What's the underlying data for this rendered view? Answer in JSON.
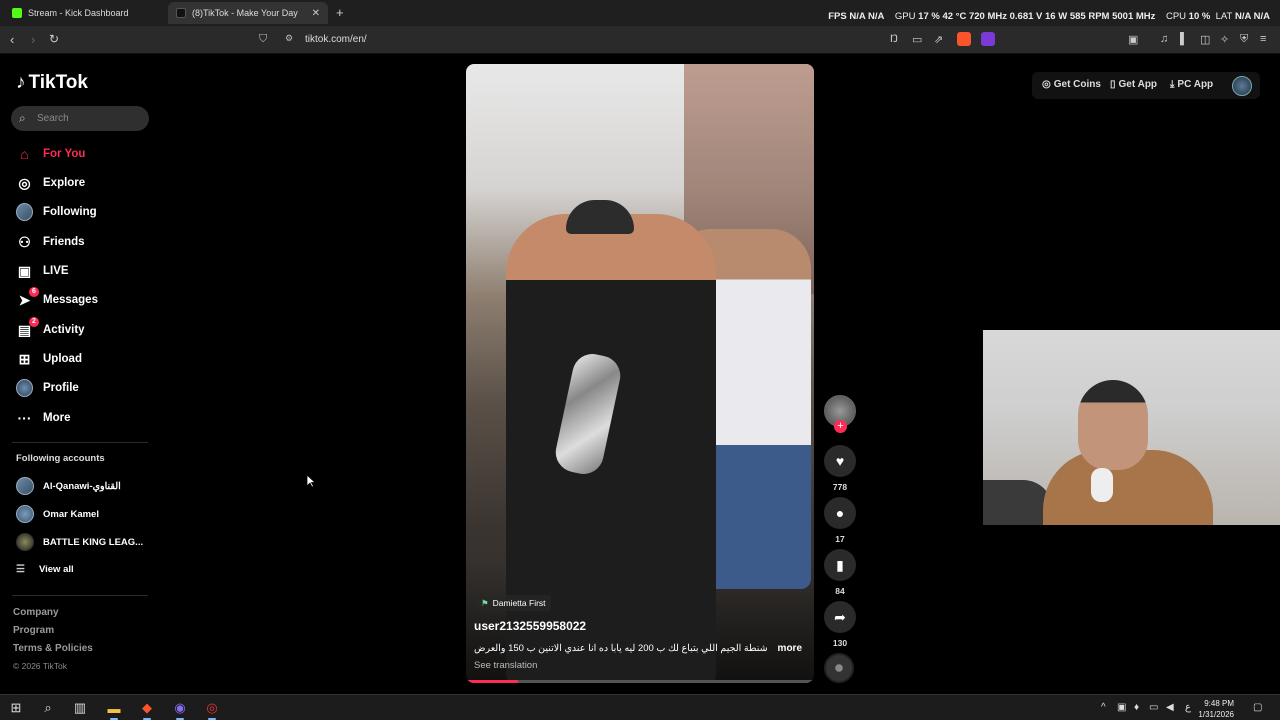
{
  "browser": {
    "tabs": [
      {
        "title": "Stream - Kick Dashboard",
        "favicon_color": "#53fc18"
      },
      {
        "title": "(8)TikTok - Make Your Day",
        "favicon_color": "#111111"
      }
    ],
    "url": "tiktok.com/en/"
  },
  "overlay": {
    "fps_label": "FPS",
    "fps1": "N/A",
    "fps2": "N/A",
    "gpu_label": "GPU",
    "gpu_load": "17 %",
    "gpu_temp": "42 °C",
    "gpu_clock": "720 MHz",
    "gpu_volt": "0.681 V",
    "gpu_power": "16 W",
    "gpu_fan": "585 RPM",
    "gpu_mem": "5001 MHz",
    "cpu_label": "CPU",
    "cpu_load": "10 %",
    "lat_label": "LAT",
    "lat1": "N/A",
    "lat2": "N/A"
  },
  "sidebar": {
    "logo": "TikTok",
    "search_placeholder": "Search",
    "nav": [
      {
        "label": "For You",
        "icon": "home-icon"
      },
      {
        "label": "Explore",
        "icon": "compass-icon"
      },
      {
        "label": "Following",
        "icon": "avatar-icon"
      },
      {
        "label": "Friends",
        "icon": "friends-icon"
      },
      {
        "label": "LIVE",
        "icon": "live-icon"
      },
      {
        "label": "Messages",
        "icon": "messages-icon",
        "badge": "6"
      },
      {
        "label": "Activity",
        "icon": "activity-icon",
        "badge": "2"
      },
      {
        "label": "Upload",
        "icon": "upload-icon"
      },
      {
        "label": "Profile",
        "icon": "profile-icon"
      },
      {
        "label": "More",
        "icon": "more-icon"
      }
    ],
    "following_title": "Following accounts",
    "accounts": [
      "Al-Qanawi-القناوي",
      "Omar Kamel",
      "BATTLE KING LEAG..."
    ],
    "view_all": "View all",
    "footer": [
      "Company",
      "Program",
      "Terms & Policies"
    ],
    "copyright": "© 2026 TikTok"
  },
  "video": {
    "location": "Damietta First",
    "username": "user2132559958022",
    "caption": "شنطة الجيم اللي بتباع لك ب 200 ليه يابا ده انا عندي الاتنين ب 150 والعرض",
    "more": "more",
    "translate": "See translation",
    "progress": 0.15
  },
  "actions": {
    "likes": "778",
    "comments": "17",
    "saves": "84",
    "shares": "130"
  },
  "topbar": {
    "get_coins": "Get Coins",
    "get_app": "Get App",
    "pc_app": "PC App"
  },
  "taskbar": {
    "time": "9:48 PM",
    "date": "1/31/2026",
    "lang": "ع"
  },
  "colors": {
    "accent": "#fe2c55",
    "background": "#000000"
  }
}
